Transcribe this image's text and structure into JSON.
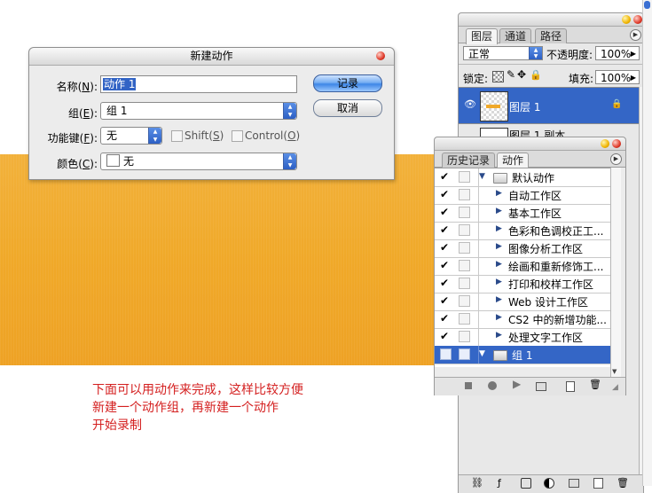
{
  "layers_palette": {
    "tabs": [
      "图层",
      "通道",
      "路径"
    ],
    "blend_mode": "正常",
    "opacity_label": "不透明度:",
    "opacity_value": "100%",
    "lock_label": "锁定:",
    "fill_label": "填充:",
    "fill_value": "100%",
    "layers": [
      {
        "name": "图层 1",
        "selected": true
      },
      {
        "name": "图层 1 副本",
        "selected": false
      }
    ]
  },
  "actions_palette": {
    "tabs": [
      "历史记录",
      "动作"
    ],
    "rows": [
      {
        "label": "默认动作",
        "type": "set",
        "expanded": true,
        "checked": true,
        "selected": false
      },
      {
        "label": "自动工作区",
        "type": "action",
        "checked": true,
        "selected": false
      },
      {
        "label": "基本工作区",
        "type": "action",
        "checked": true,
        "selected": false
      },
      {
        "label": "色彩和色调校正工...",
        "type": "action",
        "checked": true,
        "selected": false
      },
      {
        "label": "图像分析工作区",
        "type": "action",
        "checked": true,
        "selected": false
      },
      {
        "label": "绘画和重新修饰工...",
        "type": "action",
        "checked": true,
        "selected": false
      },
      {
        "label": "打印和校样工作区",
        "type": "action",
        "checked": true,
        "selected": false
      },
      {
        "label": "Web 设计工作区",
        "type": "action",
        "checked": true,
        "selected": false
      },
      {
        "label": "CS2 中的新增功能...",
        "type": "action",
        "checked": true,
        "selected": false
      },
      {
        "label": "处理文字工作区",
        "type": "action",
        "checked": true,
        "selected": false
      },
      {
        "label": "组 1",
        "type": "set",
        "expanded": true,
        "checked": false,
        "selected": true
      }
    ]
  },
  "new_action_dialog": {
    "title": "新建动作",
    "name_label_pre": "名称(",
    "name_label_key": "N",
    "name_label_post": "):",
    "name_value": "动作 1",
    "set_label_pre": "组(",
    "set_label_key": "E",
    "set_label_post": "):",
    "set_value": "组 1",
    "fkey_label_pre": "功能键(",
    "fkey_label_key": "F",
    "fkey_label_post": "):",
    "fkey_value": "无",
    "shift_pre": "Shift(",
    "shift_key": "S",
    "shift_post": ")",
    "control_pre": "Control(",
    "control_key": "O",
    "control_post": ")",
    "color_label_pre": "颜色(",
    "color_label_key": "C",
    "color_label_post": "):",
    "color_value": "无",
    "record_button": "记录",
    "cancel_button": "取消"
  },
  "tutorial_note": [
    "下面可以用动作来完成，这样比较方便",
    "新建一个动作组，再新建一个动作",
    "开始录制"
  ],
  "colors": {
    "canvas_orange": "#f0a929",
    "selection_blue": "#3466c6",
    "note_red": "#d42020"
  }
}
